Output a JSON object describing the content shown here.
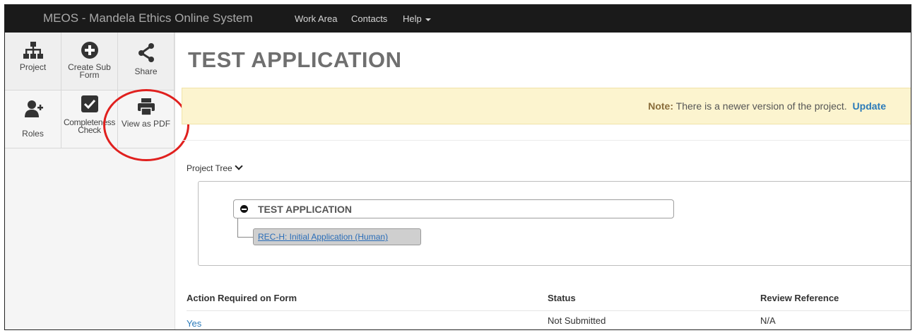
{
  "navbar": {
    "brand": "MEOS - Mandela Ethics Online System",
    "links": [
      "Work Area",
      "Contacts",
      "Help"
    ]
  },
  "sidebar": {
    "tools": [
      {
        "label": "Project",
        "icon": "sitemap-icon"
      },
      {
        "label": "Create Sub Form",
        "icon": "plus-circle-icon"
      },
      {
        "label": "Share",
        "icon": "share-icon"
      },
      {
        "label": "Roles",
        "icon": "add-user-icon"
      },
      {
        "label": "Completeness Check",
        "icon": "checkbox-icon"
      },
      {
        "label": "View as PDF",
        "icon": "print-icon"
      }
    ]
  },
  "main": {
    "title": "TEST APPLICATION",
    "notice": {
      "prefix": "Note:",
      "text": "There is a newer version of the project.",
      "link": "Update"
    },
    "tree": {
      "toggle_label": "Project Tree",
      "root": "TEST APPLICATION",
      "child": "REC-H: Initial Application (Human)"
    },
    "table": {
      "headers": [
        "Action Required on Form",
        "Status",
        "Review Reference"
      ],
      "rows": [
        [
          "Yes",
          "Not Submitted",
          "N/A"
        ]
      ]
    }
  },
  "colors": {
    "navbar_bg": "#1a1a1a",
    "notice_bg": "#fcf4cf",
    "link": "#2a7ab9",
    "highlight": "#e0201e"
  }
}
